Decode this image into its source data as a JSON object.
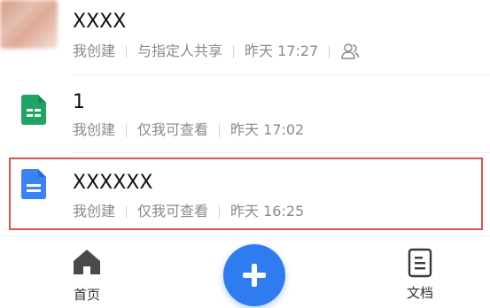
{
  "files": [
    {
      "title": "XXXX",
      "meta": [
        "我创建",
        "与指定人共享",
        "昨天 17:27"
      ],
      "type": "image"
    },
    {
      "title": "1",
      "meta": [
        "我创建",
        "仅我可查看",
        "昨天 17:02"
      ],
      "type": "sheet"
    },
    {
      "title": "XXXXXX",
      "meta": [
        "我创建",
        "仅我可查看",
        "昨天 16:25"
      ],
      "type": "doc"
    }
  ],
  "tabbar": {
    "home_label": "首页",
    "docs_label": "文档"
  },
  "colors": {
    "accent": "#2f7bf0",
    "sheet_green": "#1fa463",
    "doc_blue": "#3b82f6",
    "highlight": "#d9534f"
  },
  "icons": [
    "share-people-icon",
    "sheet-icon",
    "doc-icon",
    "home-icon",
    "plus-icon",
    "document-icon"
  ]
}
